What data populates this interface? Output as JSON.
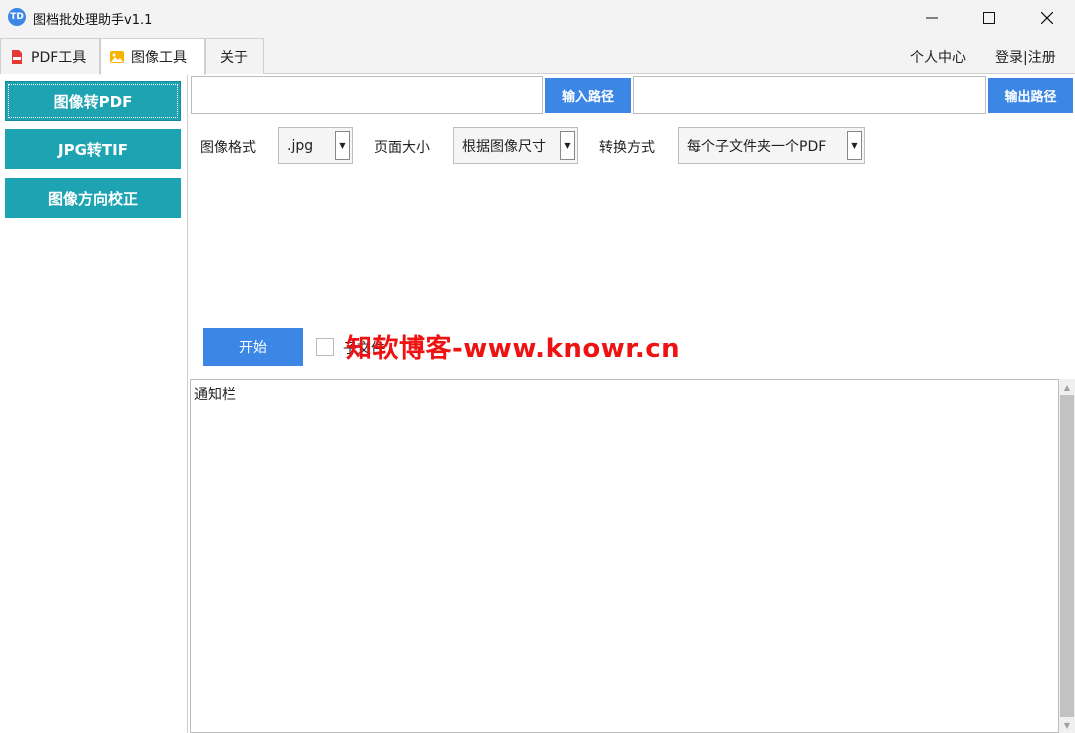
{
  "window": {
    "title": "图档批处理助手v1.1",
    "app_icon_text": "TD",
    "minimize_icon": "minimize-icon",
    "maximize_icon": "maximize-icon",
    "close_icon": "close-icon"
  },
  "tabs": [
    {
      "label": "PDF工具",
      "icon": "pdf-file-icon",
      "active": false
    },
    {
      "label": "图像工具",
      "icon": "image-file-icon",
      "active": true
    },
    {
      "label": "关于",
      "active": false
    }
  ],
  "top_links": {
    "personal_center": "个人中心",
    "login_register": "登录|注册"
  },
  "sidebar": {
    "items": [
      {
        "label": "图像转PDF",
        "active": true
      },
      {
        "label": "JPG转TIF",
        "active": false
      },
      {
        "label": "图像方向校正",
        "active": false
      }
    ]
  },
  "paths": {
    "input_value": "",
    "input_button": "输入路径",
    "output_value": "",
    "output_button": "输出路径"
  },
  "options": {
    "format_label": "图像格式",
    "format_value": ".jpg",
    "page_size_label": "页面大小",
    "page_size_value": "根据图像尺寸",
    "mode_label": "转换方式",
    "mode_value": "每个子文件夹一个PDF"
  },
  "actions": {
    "start_button": "开始",
    "checkbox_label": "子文件"
  },
  "watermark": "知软博客-www.knowr.cn",
  "notification": {
    "text": "通知栏"
  },
  "colors": {
    "accent_blue": "#3c87e6",
    "sidebar_teal": "#1ea3b2",
    "watermark_red": "#ee1212"
  }
}
